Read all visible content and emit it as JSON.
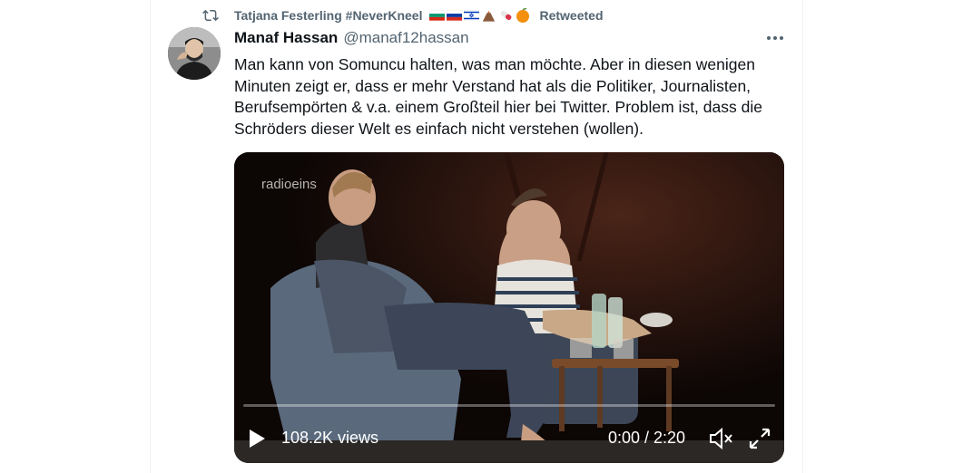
{
  "retweet": {
    "retweeter_name": "Tatjana Festerling #NeverKneel",
    "retweeted_label": "Retweeted",
    "icon": "retweet-icon",
    "emoji_flags": [
      "bulgaria-flag",
      "russia-flag",
      "israel-flag",
      "volcano-emoji",
      "pill-emoji",
      "orange-emoji"
    ]
  },
  "tweet": {
    "author_name": "Manaf Hassan",
    "author_handle": "@manaf12hassan",
    "more_icon": "more-icon",
    "text_lines": [
      "Man kann von Somuncu halten, was man möchte. Aber in diesen wenigen",
      "Minuten zeigt er, dass er mehr Verstand hat als die Politiker, Journalisten,",
      "Berufsempörten & v.a. einem Großteil hier bei Twitter. Problem ist, dass die",
      "Schröders dieser Welt es einfach nicht verstehen (wollen)."
    ]
  },
  "video": {
    "watermark": "radioeins",
    "views": "108.2K views",
    "time": "0:00 / 2:20",
    "progress": 0,
    "icons": [
      "play-icon",
      "mute-icon",
      "fullscreen-icon"
    ]
  }
}
